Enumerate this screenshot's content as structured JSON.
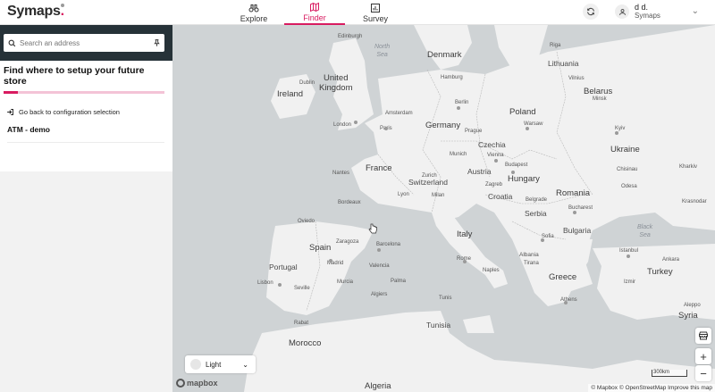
{
  "header": {
    "logo": "Symaps",
    "logo_dot": ".",
    "nav": [
      {
        "label": "Explore",
        "icon": "binoculars-icon",
        "active": false
      },
      {
        "label": "Finder",
        "icon": "map-icon",
        "active": true
      },
      {
        "label": "Survey",
        "icon": "bar-chart-icon",
        "active": false
      }
    ],
    "user": {
      "name": "d d.",
      "org": "Symaps"
    }
  },
  "sidebar": {
    "search_placeholder": "Search an address",
    "title": "Find where to setup your future store",
    "progress": 0.09,
    "back_label": "Go back to configuration selection",
    "config_name": "ATM - demo"
  },
  "map": {
    "countries": {
      "denmark": "Denmark",
      "lithuania": "Lithuania",
      "united_kingdom": "United\nKingdom",
      "ireland": "Ireland",
      "belarus": "Belarus",
      "germany": "Germany",
      "poland": "Poland",
      "czechia": "Czechia",
      "ukraine": "Ukraine",
      "france": "France",
      "austria": "Austria",
      "switzerland": "Switzerland",
      "hungary": "Hungary",
      "romania": "Romania",
      "croatia": "Croatia",
      "serbia": "Serbia",
      "bulgaria": "Bulgaria",
      "italy": "Italy",
      "spain": "Spain",
      "portugal": "Portugal",
      "albania": "Albania",
      "greece": "Greece",
      "turkey": "Turkey",
      "tunisia": "Tunisia",
      "morocco": "Morocco",
      "algeria": "Algeria",
      "syria": "Syria"
    },
    "cities": {
      "riga": "Riga",
      "vilnius": "Vilnius",
      "minsk": "Minsk",
      "dublin": "Dublin",
      "london": "London",
      "amsterdam": "Amsterdam",
      "berlin": "Berlin",
      "hamburg": "Hamburg",
      "warsaw": "Warsaw",
      "kyiv": "Kyiv",
      "kharkiv": "Kharkiv",
      "paris": "Paris",
      "prague": "Prague",
      "munich": "Munich",
      "vienna": "Vienna",
      "budapest": "Budapest",
      "zurich": "Zurich",
      "milan": "Milan",
      "nantes": "Nantes",
      "bordeaux": "Bordeaux",
      "lyon": "Lyon",
      "chisinau": "Chisinau",
      "odesa": "Odesa",
      "bucharest": "Bucharest",
      "belgrade": "Belgrade",
      "sofia": "Sofia",
      "zagreb": "Zagreb",
      "rome": "Rome",
      "naples": "Naples",
      "barcelona": "Barcelona",
      "zaragoza": "Zaragoza",
      "madrid": "Madrid",
      "valencia": "Valencia",
      "lisbon": "Lisbon",
      "seville": "Seville",
      "murcia": "Murcia",
      "palma": "Palma",
      "algiers": "Algiers",
      "tunis": "Tunis",
      "rabat": "Rabat",
      "athens": "Athens",
      "istanbul": "Istanbul",
      "ankara": "Ankara",
      "izmir": "Izmir",
      "aleppo": "Aleppo",
      "tirana": "Tirana",
      "krasnodar": "Krasnodar",
      "oviedo": "Oviedo",
      "edinburgh": "Edinburgh"
    },
    "seas": {
      "north_sea": "North\nSea",
      "black_sea": "Black\nSea"
    },
    "style_select": "Light",
    "style_chevron": "⌄",
    "zoom_in": "+",
    "zoom_out": "−",
    "scale": "300km",
    "mapbox_logo": "mapbox",
    "attribution": "© Mapbox © OpenStreetMap  Improve this map"
  },
  "colors": {
    "accent": "#d81b60",
    "sidebar_head": "#263238",
    "sea": "#cfd3d5",
    "land": "#f1f1f1"
  }
}
